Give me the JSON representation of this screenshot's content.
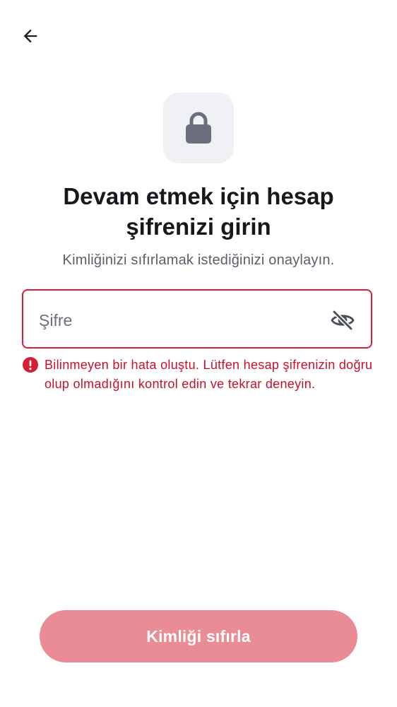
{
  "header": {
    "back_icon": "arrow-left-icon"
  },
  "hero": {
    "icon": "lock-icon",
    "title": "Devam etmek için hesap\nşifrenizi girin",
    "subtitle": "Kimliğinizi sıfırlamak istediğinizi onaylayın."
  },
  "password_field": {
    "placeholder": "Şifre",
    "value": "",
    "toggle_icon": "eye-off-icon"
  },
  "error": {
    "icon": "error-circle-icon",
    "message": "Bilinmeyen bir hata oluştu. Lütfen hesap şifrenizin doğru olup olmadığını kontrol edin ve tekrar deneyin."
  },
  "actions": {
    "reset_label": "Kimliği sıfırla"
  },
  "colors": {
    "error": "#d81e36",
    "button_disabled": "#e98c95",
    "lock_tile": "#f0f1f5",
    "lock_icon": "#6b6f7b"
  }
}
